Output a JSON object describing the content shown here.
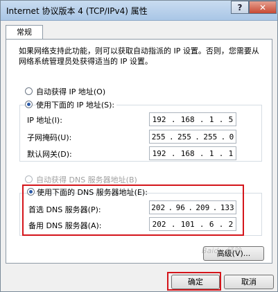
{
  "window": {
    "title": "Internet 协议版本 4 (TCP/IPv4) 属性",
    "help_label": "?",
    "close_label": "✕"
  },
  "tab": {
    "label": "常规"
  },
  "description": "如果网络支持此功能，则可以获取自动指派的 IP 设置。否则，您需要从网络系统管理员处获得适当的 IP 设置。",
  "ip": {
    "auto_label": "自动获得 IP 地址(O)",
    "manual_label": "使用下面的 IP 地址(S):",
    "selected": "manual",
    "fields": [
      {
        "label": "IP 地址(I):",
        "octets": [
          "192",
          "168",
          "1",
          "5"
        ]
      },
      {
        "label": "子网掩码(U):",
        "octets": [
          "255",
          "255",
          "255",
          "0"
        ]
      },
      {
        "label": "默认网关(D):",
        "octets": [
          "192",
          "168",
          "1",
          "1"
        ]
      }
    ]
  },
  "dns": {
    "auto_label": "自动获得 DNS 服务器地址(B)",
    "manual_label": "使用下面的 DNS 服务器地址(E):",
    "selected": "manual",
    "fields": [
      {
        "label": "首选 DNS 服务器(P):",
        "octets": [
          "202",
          "96",
          "209",
          "133"
        ]
      },
      {
        "label": "备用 DNS 服务器(A):",
        "octets": [
          "202",
          "101",
          "6",
          "2"
        ]
      }
    ]
  },
  "buttons": {
    "advanced": "高级(V)...",
    "ok": "确定",
    "cancel": "取消"
  },
  "highlight_color": "#d4141a",
  "watermark": "Baidu 经验"
}
